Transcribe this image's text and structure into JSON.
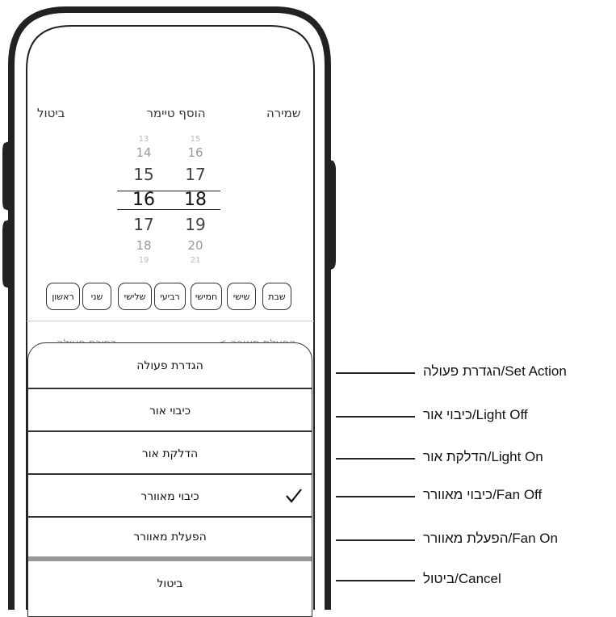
{
  "header": {
    "cancel": "ביטול",
    "title": "הוסף טיימר",
    "save": "שמירה"
  },
  "picker": {
    "col_left": [
      "13",
      "14",
      "15",
      "16",
      "17",
      "18",
      "19"
    ],
    "col_right": [
      "15",
      "16",
      "17",
      "18",
      "19",
      "20",
      "21"
    ]
  },
  "days": [
    "ראשון",
    "שני",
    "שלישי",
    "רביעי",
    "חמישי",
    "שישי",
    "שבת"
  ],
  "behind_sheet": {
    "right_label": "< הפעלת תאורה",
    "left_label": "בחירת פעולה"
  },
  "sheet": {
    "title": "הגדרת פעולה",
    "options": [
      "כיבוי אור",
      "הדלקת אור",
      "כיבוי מאוורר",
      "הפעלת מאוורר"
    ],
    "selected_index": 2,
    "cancel": "ביטול"
  },
  "callouts": [
    "הגדרת פעולה/Set Action",
    "כיבוי אור/Light Off",
    "הדלקת אור/Light On",
    "כיבוי מאוורר/Fan Off",
    "הפעלת מאוורר/Fan On",
    "ביטול/Cancel"
  ]
}
